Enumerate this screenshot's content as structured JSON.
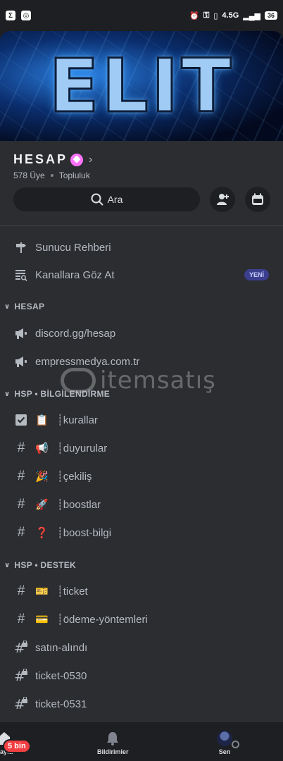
{
  "status_bar": {
    "network": "4.5G",
    "battery": "36"
  },
  "banner": {
    "logo_text": "ELIT"
  },
  "server": {
    "name": "HESAP",
    "member_count": "578 Üye",
    "type": "Topluluk"
  },
  "search": {
    "label": "Ara"
  },
  "menu": {
    "server_guide": "Sunucu Rehberi",
    "browse_channels": "Kanallara Göz At",
    "browse_badge": "YENİ"
  },
  "categories": [
    {
      "name": "HESAP",
      "channels": [
        {
          "name": "discord.gg/hesap",
          "icon": "announcement-icon",
          "emoji": ""
        },
        {
          "name": "empressmedya.com.tr",
          "icon": "announcement-icon",
          "emoji": ""
        }
      ]
    },
    {
      "name": "HSP • BİLGİLENDİRME",
      "channels": [
        {
          "name": "┊kurallar",
          "icon": "rules-icon",
          "emoji": "📋"
        },
        {
          "name": "┊duyurular",
          "icon": "hash-icon",
          "emoji": "📢"
        },
        {
          "name": "┊çekiliş",
          "icon": "hash-icon",
          "emoji": "🎉"
        },
        {
          "name": "┊boostlar",
          "icon": "hash-icon",
          "emoji": "🚀"
        },
        {
          "name": "┊boost-bilgi",
          "icon": "hash-icon",
          "emoji": "❓"
        }
      ]
    },
    {
      "name": "HSP • DESTEK",
      "channels": [
        {
          "name": "┊ticket",
          "icon": "hash-icon",
          "emoji": "🎫"
        },
        {
          "name": "┊ödeme-yöntemleri",
          "icon": "hash-icon",
          "emoji": "💳"
        },
        {
          "name": "satın-alındı",
          "icon": "locked-hash-icon",
          "emoji": ""
        },
        {
          "name": "ticket-0530",
          "icon": "locked-hash-icon",
          "emoji": ""
        },
        {
          "name": "ticket-0531",
          "icon": "locked-hash-icon",
          "emoji": ""
        }
      ]
    }
  ],
  "watermark": {
    "text": "itemsatış"
  },
  "bottom_nav": {
    "home_label": "Sayfa",
    "home_badge": "5 bin",
    "notifications_label": "Bildirimler",
    "you_label": "Sen"
  },
  "colors": {
    "background": "#1e1f22",
    "panel": "#2b2d31",
    "new_badge": "#3c3f8f",
    "notification_badge": "#f23f43",
    "boost_pink": "#ff73fa"
  }
}
